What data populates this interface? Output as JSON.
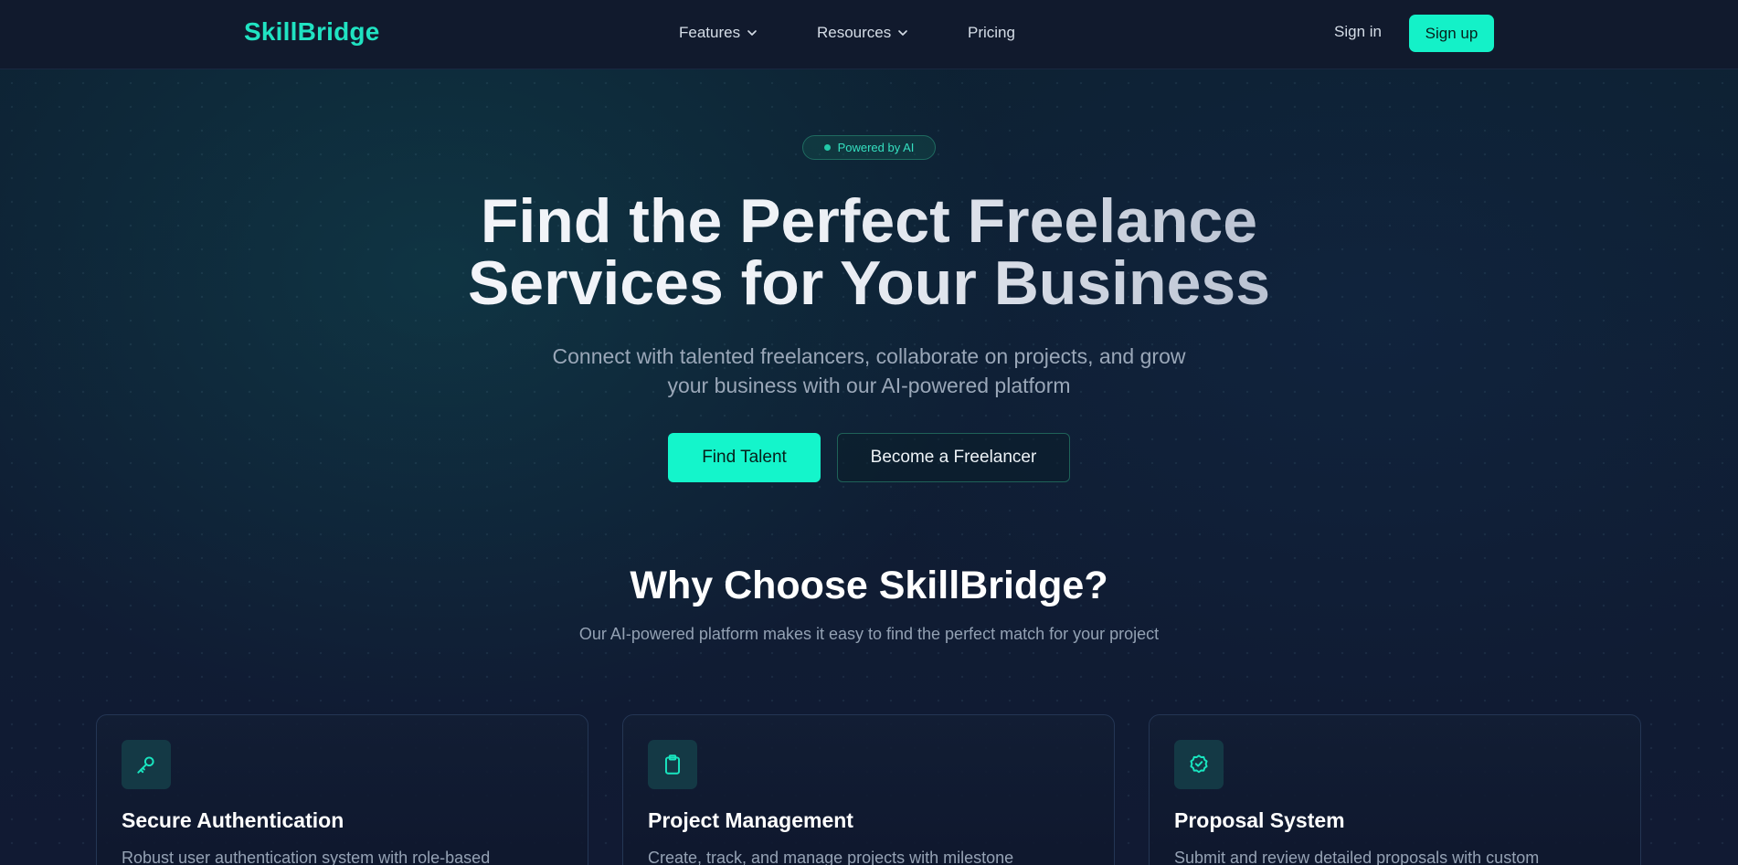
{
  "nav": {
    "logo": "SkillBridge",
    "features": "Features",
    "resources": "Resources",
    "pricing": "Pricing",
    "sign_in": "Sign in",
    "sign_up": "Sign up"
  },
  "hero": {
    "badge": "Powered by AI",
    "title_line1": "Find the Perfect Freelance",
    "title_line2": "Services for Your Business",
    "subtitle_line1": "Connect with talented freelancers, collaborate on projects, and grow",
    "subtitle_line2": "your business with our AI-powered platform",
    "primary_cta": "Find Talent",
    "secondary_cta": "Become a Freelancer"
  },
  "why": {
    "title": "Why Choose SkillBridge?",
    "subtitle": "Our AI-powered platform makes it easy to find the perfect match for your project"
  },
  "features": [
    {
      "icon": "key-icon",
      "title": "Secure Authentication",
      "desc": "Robust user authentication system with role-based"
    },
    {
      "icon": "clipboard-icon",
      "title": "Project Management",
      "desc": "Create, track, and manage projects with milestone"
    },
    {
      "icon": "badge-check-icon",
      "title": "Proposal System",
      "desc": "Submit and review detailed proposals with custom"
    }
  ],
  "colors": {
    "accent": "#14f1c8",
    "logo": "#20e3c2",
    "background": "#0f1a2e",
    "nav_background": "#111a2d"
  }
}
